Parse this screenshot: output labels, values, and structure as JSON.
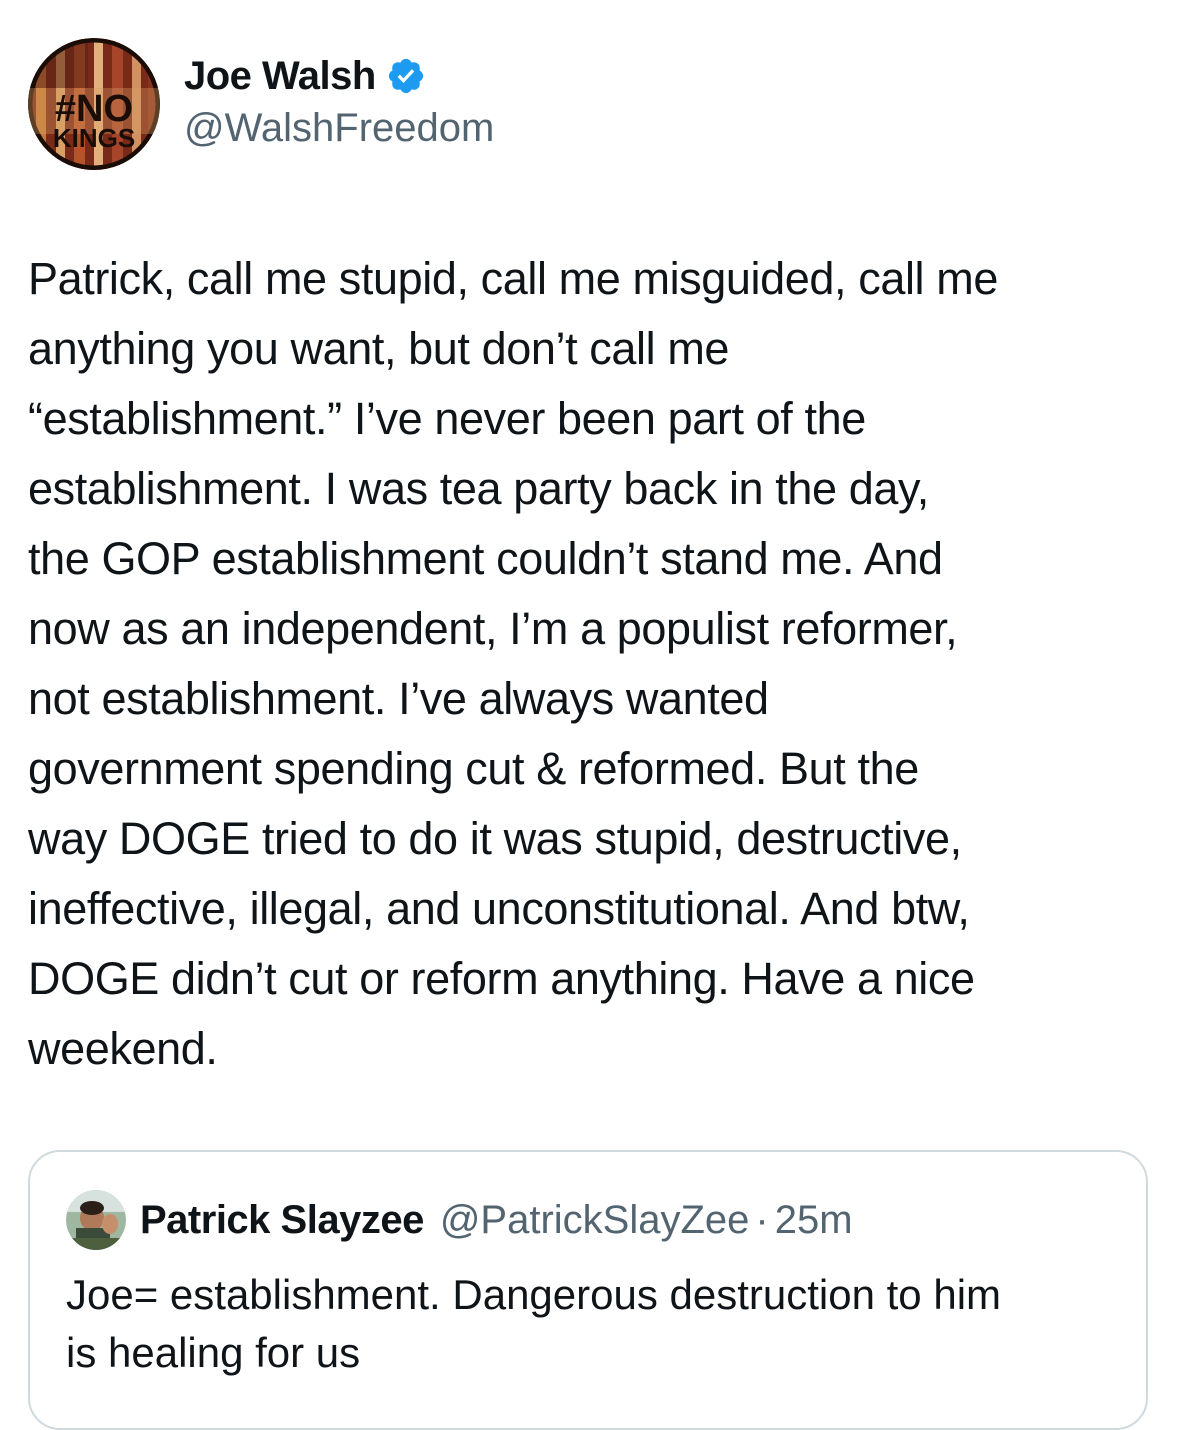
{
  "author": {
    "avatar_text_line1": "#NO",
    "avatar_text_line2": "KINGS",
    "display_name": "Joe Walsh",
    "verified_icon": "verified-badge-icon",
    "handle": "@WalshFreedom"
  },
  "tweet": {
    "text": "Patrick, call me stupid, call me misguided, call me\nanything you want, but don’t call me\n“establishment.” I’ve never been part of the\nestablishment. I was tea party back in the day,\nthe GOP establishment couldn’t stand me. And\nnow as an independent, I’m a populist reformer,\nnot establishment. I’ve always wanted\ngovernment spending cut & reformed. But the\nway DOGE tried to do it was stupid, destructive,\nineffective, illegal, and unconstitutional. And btw,\nDOGE didn’t cut or reform anything. Have a nice\nweekend."
  },
  "quoted_tweet": {
    "display_name": "Patrick Slayzee",
    "handle": "@PatrickSlayZee",
    "separator": "·",
    "time": "25m",
    "text": "Joe= establishment. Dangerous destruction to him\nis healing for us"
  },
  "colors": {
    "text": "#0f1419",
    "secondary": "#536471",
    "verified": "#1d9bf0",
    "border": "#cfd9de"
  }
}
